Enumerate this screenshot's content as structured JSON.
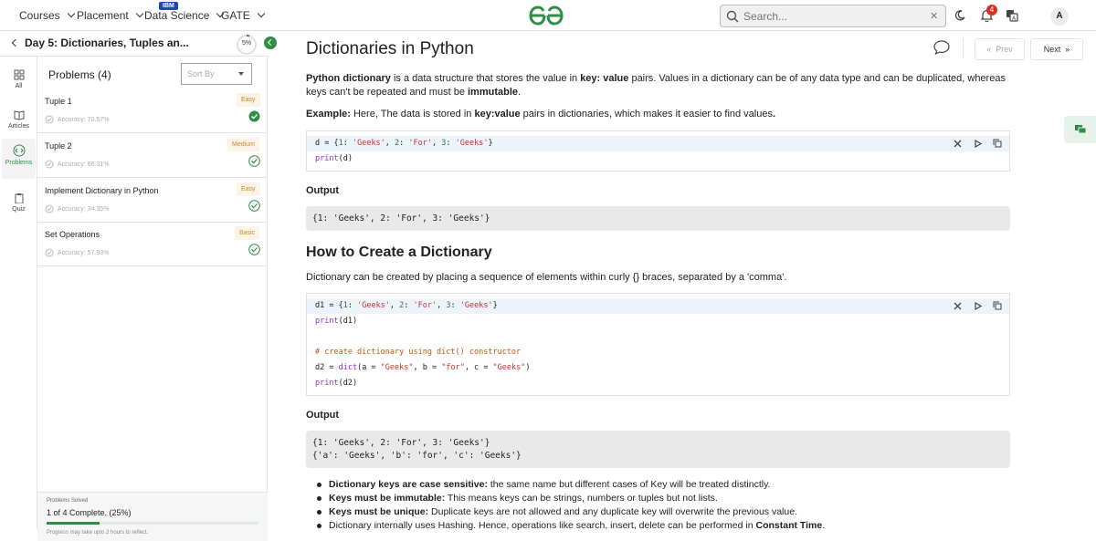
{
  "nav": {
    "courses": "Courses",
    "placement": "Placement",
    "data_science": "Data Science",
    "ibm_badge": "IBM",
    "gate": "GATE",
    "search_placeholder": "Search...",
    "notif_count": "4",
    "avatar_initial": "A"
  },
  "sidebar": {
    "course_title": "Day 5: Dictionaries, Tuples an...",
    "progress": "5%",
    "progress_value": 0.05,
    "rail": [
      "All",
      "Articles",
      "Problems",
      "Quiz"
    ]
  },
  "problems": {
    "title": "Problems (4)",
    "sort_label": "Sort By",
    "items": [
      {
        "name": "Tuple 1",
        "accuracy": "Accuracy: 70.57%",
        "difficulty": "Easy",
        "status": "solved"
      },
      {
        "name": "Tuple 2",
        "accuracy": "Accuracy: 66.31%",
        "difficulty": "Medium",
        "status": "unsolved"
      },
      {
        "name": "Implement Dictionary in Python",
        "accuracy": "Accuracy: 34.35%",
        "difficulty": "Easy",
        "status": "unsolved"
      },
      {
        "name": "Set Operations",
        "accuracy": "Accuracy: 57.93%",
        "difficulty": "Basic",
        "status": "unsolved"
      }
    ],
    "solved_label": "Problems Solved",
    "solved_text": "1 of 4 Complete. (25%)",
    "solved_fraction": 0.25,
    "note": "Progress may take upto 2 hours to reflect."
  },
  "article": {
    "title": "Dictionaries in Python",
    "prev": "Prev",
    "next": "Next",
    "intro": {
      "b1": "Python dictionary",
      "t1": " is a data structure that stores the value in ",
      "b2": "key: value",
      "t2": " pairs. Values in a dictionary can be of any data type and can be duplicated, whereas keys can't be repeated and must be ",
      "b3": "immutable",
      "t3": "."
    },
    "example": {
      "b1": "Example:",
      "t1": " Here, The data is stored in ",
      "b2": "key:value",
      "t2": " pairs in dictionaries, which makes it easier to find values",
      "b3": "."
    },
    "code1": [
      "d = {1: 'Geeks', 2: 'For', 3: 'Geeks'}",
      "print(d)"
    ],
    "output_label_1": "Output",
    "output1": [
      "{1: 'Geeks', 2: 'For', 3: 'Geeks'}"
    ],
    "h2": "How to Create a Dictionary",
    "create_para": "Dictionary can be created by placing a sequence of elements within curly {} braces, separated by a 'comma'.",
    "code2": [
      "d1 = {1: 'Geeks', 2: 'For', 3: 'Geeks'}",
      "print(d1)",
      "",
      "# create dictionary using dict() constructor",
      "d2 = dict(a = \"Geeks\", b = \"for\", c = \"Geeks\")",
      "print(d2)"
    ],
    "output_label_2": "Output",
    "output2": [
      "{1: 'Geeks', 2: 'For', 3: 'Geeks'}",
      "{'a': 'Geeks', 'b': 'for', 'c': 'Geeks'}"
    ],
    "bullets": [
      {
        "b": "Dictionary keys are case sensitive:",
        "t": " the same name but different cases of Key will be treated distinctly."
      },
      {
        "b": "Keys must be immutable:",
        "t": " This means keys can be strings, numbers or tuples but not lists."
      },
      {
        "b": "Keys must be unique:",
        "t": " Duplicate keys are not allowed and any duplicate key will overwrite the previous value."
      },
      {
        "b": "",
        "t": "Dictionary internally uses Hashing. Hence, operations like search, insert, delete can be performed in ",
        "b2": "Constant Time",
        "t2": "."
      }
    ]
  },
  "colors": {
    "brand_green": "#2f8d46",
    "easy": "#c88a2a"
  }
}
